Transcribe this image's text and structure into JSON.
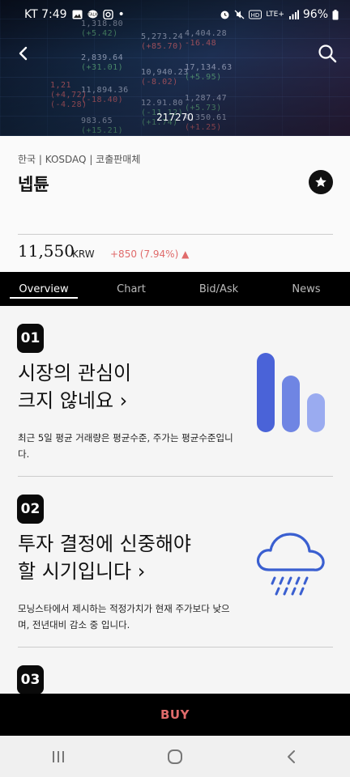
{
  "status_bar": {
    "carrier_time": "KT 7:49",
    "dot": "•",
    "network": "LTE+",
    "battery": "96%"
  },
  "header": {
    "stock_code": "217270",
    "back_icon": "back-arrow-icon",
    "search_icon": "search-icon"
  },
  "stock": {
    "breadcrumb": "한국 | KOSDAQ | 코출판매체",
    "name": "넵튠",
    "favorite_icon": "star-icon",
    "price": "11,550",
    "currency": "KRW",
    "change": "+850 (7.94%) ▲",
    "change_color": "#e06b6b"
  },
  "tabs": [
    {
      "label": "Overview",
      "active": true
    },
    {
      "label": "Chart",
      "active": false
    },
    {
      "label": "Bid/Ask",
      "active": false
    },
    {
      "label": "News",
      "active": false
    }
  ],
  "cards": [
    {
      "number": "01",
      "title_line1": "시장의 관심이",
      "title_line2": "크지 않네요 ›",
      "description": "최근 5일 평균 거래량은 평균수준, 주가는 평균수준입니다.",
      "icon": "volume-bars-icon",
      "icon_color": "#4a63d8"
    },
    {
      "number": "02",
      "title_line1": "투자 결정에 신중해야",
      "title_line2": "할 시기입니다 ›",
      "description": "모닝스타에서 제시하는 적정가치가 현재 주가보다 낮으며, 전년대비 감소 중 입니다.",
      "icon": "rain-cloud-icon",
      "icon_color": "#3a5fd0"
    },
    {
      "number": "03"
    }
  ],
  "buy_button": "BUY",
  "buy_color": "#e06b6b"
}
